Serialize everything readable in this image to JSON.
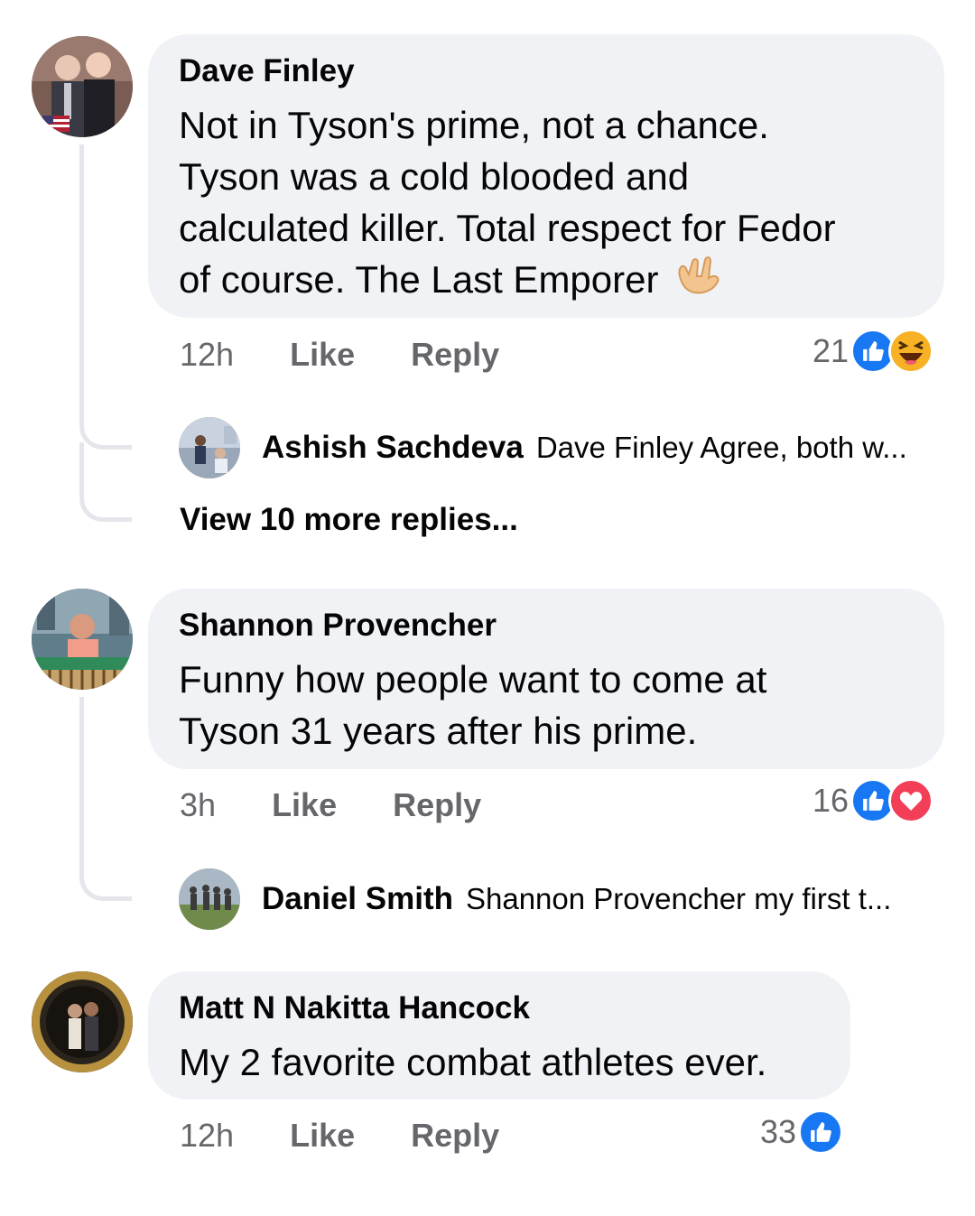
{
  "comments": [
    {
      "author": "Dave Finley",
      "lines": [
        "Not in Tyson's prime, not a chance.",
        "Tyson was a cold blooded and",
        "calculated killer. Total respect for Fedor",
        "of course. The Last Emporer"
      ],
      "emoji": "🤟",
      "time": "12h",
      "like_label": "Like",
      "reply_label": "Reply",
      "reaction_count": "21",
      "reactions": [
        "like-icon",
        "haha-icon"
      ],
      "reply_preview": {
        "author": "Ashish Sachdeva",
        "text": "Dave Finley Agree, both w..."
      },
      "view_more": "View 10 more replies..."
    },
    {
      "author": "Shannon Provencher",
      "lines": [
        "Funny how people want to come at",
        "Tyson 31 years after his prime."
      ],
      "time": "3h",
      "like_label": "Like",
      "reply_label": "Reply",
      "reaction_count": "16",
      "reactions": [
        "like-icon",
        "love-icon"
      ],
      "reply_preview": {
        "author": "Daniel Smith",
        "text": "Shannon Provencher my first t..."
      }
    },
    {
      "author": "Matt N Nakitta Hancock",
      "lines": [
        "My 2 favorite combat athletes ever."
      ],
      "time": "12h",
      "like_label": "Like",
      "reply_label": "Reply",
      "reaction_count": "33",
      "reactions": [
        "like-icon"
      ]
    }
  ],
  "colors": {
    "bubble": "#f0f2f5",
    "meta_text": "#65676b",
    "like_blue": "#1877f2",
    "love_red": "#f33e58",
    "haha_yellow": "#f7b125"
  }
}
